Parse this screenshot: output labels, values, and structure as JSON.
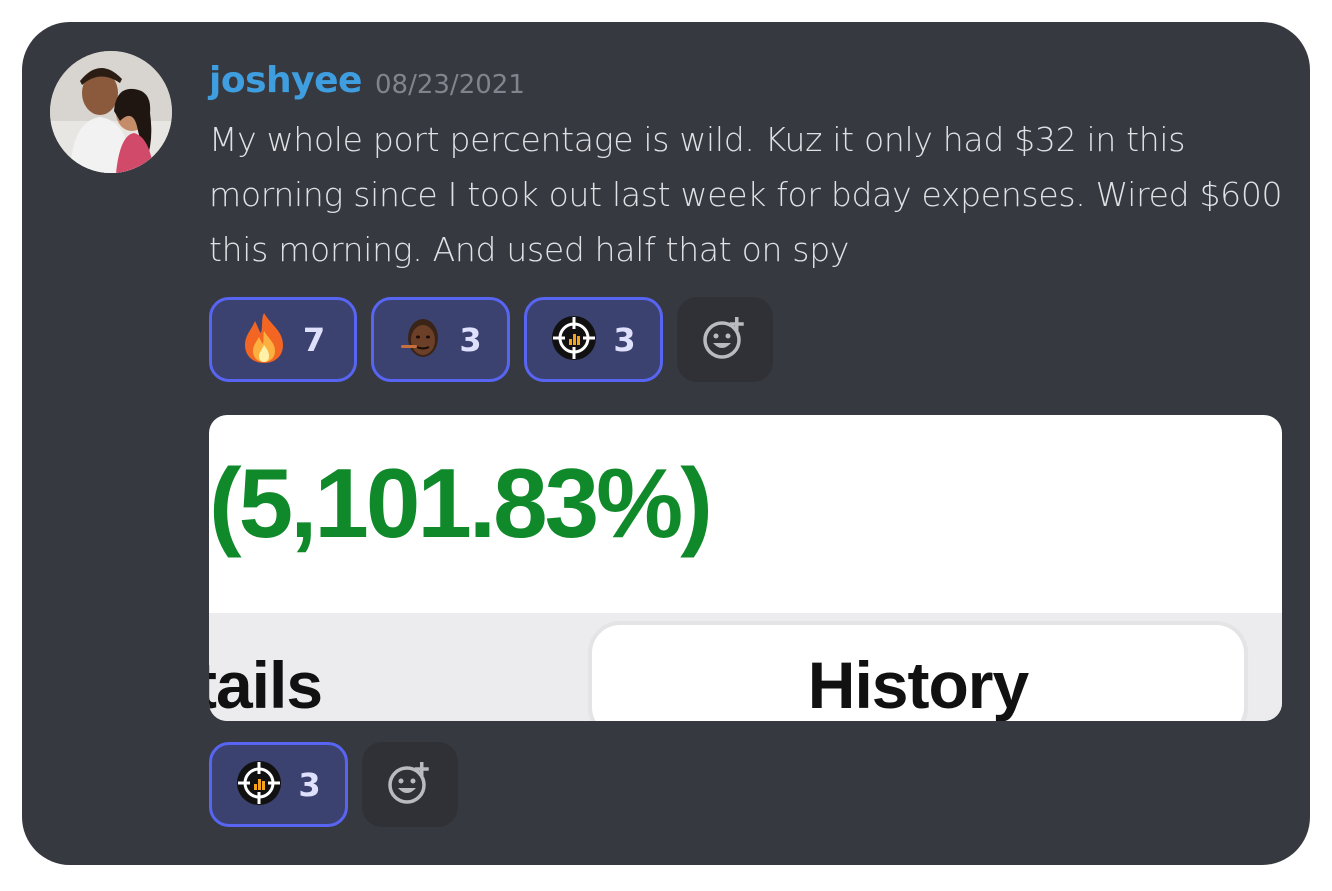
{
  "message": {
    "username": "joshyee",
    "timestamp": "08/23/2021",
    "text": "My whole port percentage is wild. Kuz it only had $32 in this morning since I took out last week for bday expenses. Wired $600 this morning. And used half that on spy"
  },
  "reactions": [
    {
      "icon": "fire-emoji-icon",
      "count": "7"
    },
    {
      "icon": "custom-face-emoji-icon",
      "count": "3"
    },
    {
      "icon": "crosshair-logo-emoji-icon",
      "count": "3"
    }
  ],
  "embed": {
    "percent_text": "(5,101.83%)",
    "tab_details_label": "tails",
    "tab_history_label": "History"
  },
  "embed_reactions": [
    {
      "icon": "crosshair-logo-emoji-icon",
      "count": "3"
    }
  ],
  "colors": {
    "background": "#36393f",
    "username": "#3f9ee0",
    "reaction_border": "#5865f2",
    "percent_green": "#10892b"
  }
}
